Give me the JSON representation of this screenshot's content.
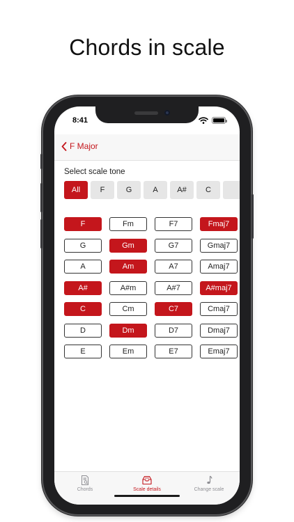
{
  "headline": "Chords in scale",
  "status": {
    "time": "8:41"
  },
  "nav": {
    "back_label": "F Major"
  },
  "section_label": "Select scale tone",
  "tones": [
    {
      "label": "All",
      "selected": true
    },
    {
      "label": "F",
      "selected": false
    },
    {
      "label": "G",
      "selected": false
    },
    {
      "label": "A",
      "selected": false
    },
    {
      "label": "A#",
      "selected": false
    },
    {
      "label": "C",
      "selected": false
    },
    {
      "label": "",
      "selected": false
    }
  ],
  "chord_rows": [
    [
      {
        "label": "F",
        "active": true
      },
      {
        "label": "Fm",
        "active": false
      },
      {
        "label": "F7",
        "active": false
      },
      {
        "label": "Fmaj7",
        "active": true
      }
    ],
    [
      {
        "label": "G",
        "active": false
      },
      {
        "label": "Gm",
        "active": true
      },
      {
        "label": "G7",
        "active": false
      },
      {
        "label": "Gmaj7",
        "active": false
      }
    ],
    [
      {
        "label": "A",
        "active": false
      },
      {
        "label": "Am",
        "active": true
      },
      {
        "label": "A7",
        "active": false
      },
      {
        "label": "Amaj7",
        "active": false
      }
    ],
    [
      {
        "label": "A#",
        "active": true
      },
      {
        "label": "A#m",
        "active": false
      },
      {
        "label": "A#7",
        "active": false
      },
      {
        "label": "A#maj7",
        "active": true
      }
    ],
    [
      {
        "label": "C",
        "active": true
      },
      {
        "label": "Cm",
        "active": false
      },
      {
        "label": "C7",
        "active": true
      },
      {
        "label": "Cmaj7",
        "active": false
      }
    ],
    [
      {
        "label": "D",
        "active": false
      },
      {
        "label": "Dm",
        "active": true
      },
      {
        "label": "D7",
        "active": false
      },
      {
        "label": "Dmaj7",
        "active": false
      }
    ],
    [
      {
        "label": "E",
        "active": false
      },
      {
        "label": "Em",
        "active": false
      },
      {
        "label": "E7",
        "active": false
      },
      {
        "label": "Emaj7",
        "active": false
      }
    ]
  ],
  "tabs": [
    {
      "label": "Chords",
      "icon": "document-search-icon",
      "selected": false
    },
    {
      "label": "Scale details",
      "icon": "tray-icon",
      "selected": true
    },
    {
      "label": "Change scale",
      "icon": "music-note-icon",
      "selected": false
    }
  ],
  "colors": {
    "accent": "#c4161c",
    "chip_bg": "#e6e6e6",
    "bar_bg": "#f7f7f7"
  }
}
